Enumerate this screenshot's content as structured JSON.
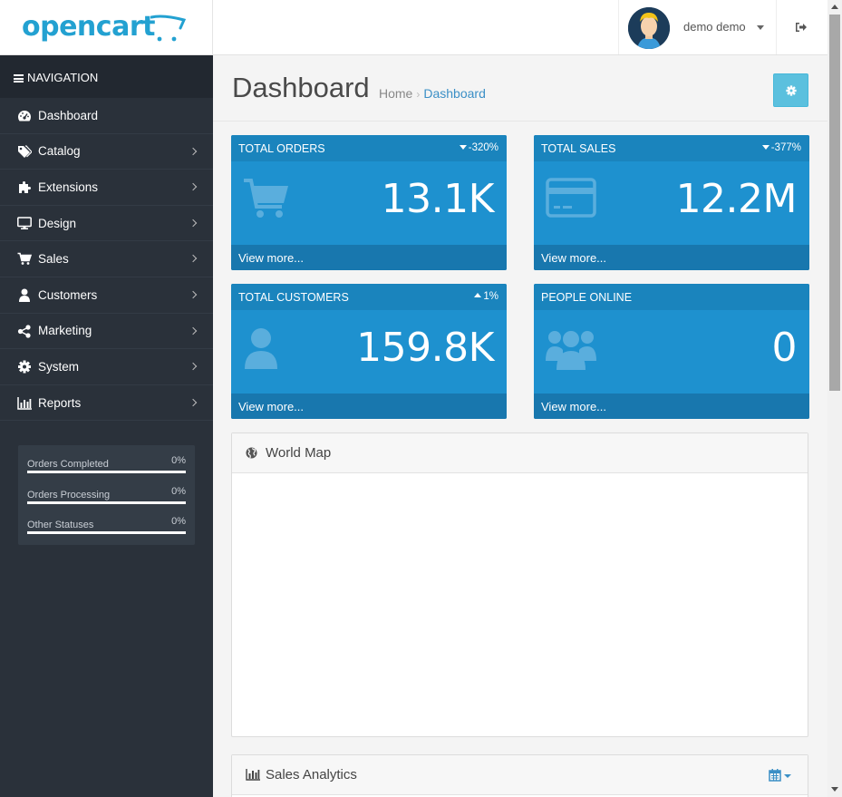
{
  "header": {
    "logo_text": "opencart",
    "user_name": "demo demo"
  },
  "sidebar": {
    "nav_title": "NAVIGATION",
    "items": [
      {
        "label": "Dashboard",
        "icon": "dashboard-icon",
        "has_children": false
      },
      {
        "label": "Catalog",
        "icon": "tags-icon",
        "has_children": true
      },
      {
        "label": "Extensions",
        "icon": "puzzle-icon",
        "has_children": true
      },
      {
        "label": "Design",
        "icon": "monitor-icon",
        "has_children": true
      },
      {
        "label": "Sales",
        "icon": "cart-icon",
        "has_children": true
      },
      {
        "label": "Customers",
        "icon": "user-icon",
        "has_children": true
      },
      {
        "label": "Marketing",
        "icon": "share-icon",
        "has_children": true
      },
      {
        "label": "System",
        "icon": "gear-icon",
        "has_children": true
      },
      {
        "label": "Reports",
        "icon": "bar-chart-icon",
        "has_children": true
      }
    ],
    "stats": [
      {
        "label": "Orders Completed",
        "value": "0%"
      },
      {
        "label": "Orders Processing",
        "value": "0%"
      },
      {
        "label": "Other Statuses",
        "value": "0%"
      }
    ]
  },
  "main": {
    "title": "Dashboard",
    "breadcrumb": {
      "home": "Home",
      "current": "Dashboard"
    },
    "tiles": [
      {
        "title": "TOTAL ORDERS",
        "change": "-320%",
        "direction": "down",
        "value": "13.1K",
        "icon": "cart-icon",
        "footer": "View more..."
      },
      {
        "title": "TOTAL SALES",
        "change": "-377%",
        "direction": "down",
        "value": "12.2M",
        "icon": "credit-card-icon",
        "footer": "View more..."
      },
      {
        "title": "TOTAL CUSTOMERS",
        "change": "1%",
        "direction": "up",
        "value": "159.8K",
        "icon": "user-icon",
        "footer": "View more..."
      },
      {
        "title": "PEOPLE ONLINE",
        "change": "",
        "direction": "none",
        "value": "0",
        "icon": "users-icon",
        "footer": "View more..."
      }
    ],
    "world_map": {
      "title": "World Map"
    },
    "sales_analytics": {
      "title": "Sales Analytics"
    }
  },
  "colors": {
    "brand": "#23a1d1",
    "sidebar_bg": "#2a313a",
    "tile_bg": "#1e91cf",
    "settings_button": "#5bc0de"
  }
}
